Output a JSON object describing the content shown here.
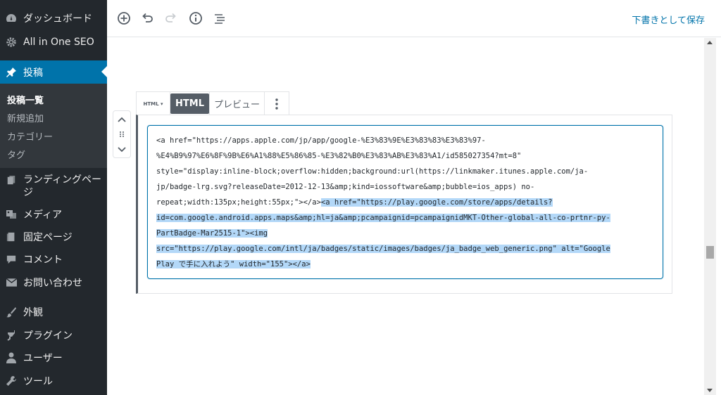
{
  "sidebar": {
    "items": [
      {
        "label": "ダッシュボード",
        "icon": "dashboard-icon"
      },
      {
        "label": "All in One SEO",
        "icon": "gear-icon"
      },
      {
        "label": "投稿",
        "icon": "pin-icon"
      },
      {
        "label": "ランディングページ",
        "icon": "pages-icon"
      },
      {
        "label": "メディア",
        "icon": "media-icon"
      },
      {
        "label": "固定ページ",
        "icon": "page-icon"
      },
      {
        "label": "コメント",
        "icon": "comment-icon"
      },
      {
        "label": "お問い合わせ",
        "icon": "mail-icon"
      },
      {
        "label": "外観",
        "icon": "brush-icon"
      },
      {
        "label": "プラグイン",
        "icon": "plugin-icon"
      },
      {
        "label": "ユーザー",
        "icon": "user-icon"
      },
      {
        "label": "ツール",
        "icon": "wrench-icon"
      }
    ],
    "submenu": [
      "投稿一覧",
      "新規追加",
      "カテゴリー",
      "タグ"
    ]
  },
  "toolbar": {
    "save_draft": "下書きとして保存"
  },
  "block": {
    "switcher_label": "HTML ▾",
    "tab_html": "HTML",
    "tab_preview": "プレビュー",
    "code_lines": [
      "<a href=\"https://apps.apple.com/jp/app/google-%E3%83%9E%E3%83%83%E3%83%97-",
      "%E4%B9%97%E6%8F%9B%E6%A1%88%E5%86%85-%E3%82%B0%E3%83%AB%E3%83%A1/id585027354?mt=8\"",
      "style=\"display:inline-block;overflow:hidden;background:url(https://linkmaker.itunes.apple.com/ja-",
      "jp/badge-lrg.svg?releaseDate=2012-12-13&amp;kind=iossoftware&amp;bubble=ios_apps) no-",
      "repeat;width:135px;height:55px;\"></a>",
      "<a href=\"https://play.google.com/store/apps/details?",
      "id=com.google.android.apps.maps&amp;hl=ja&amp;pcampaignid=pcampaignidMKT-Other-global-all-co-prtnr-py-",
      "PartBadge-Mar2515-1\"><img",
      "src=\"https://play.google.com/intl/ja/badges/static/images/badges/ja_badge_web_generic.png\" alt=\"Google",
      "Play で手に入れよう\" width=\"155\"></a>"
    ]
  }
}
